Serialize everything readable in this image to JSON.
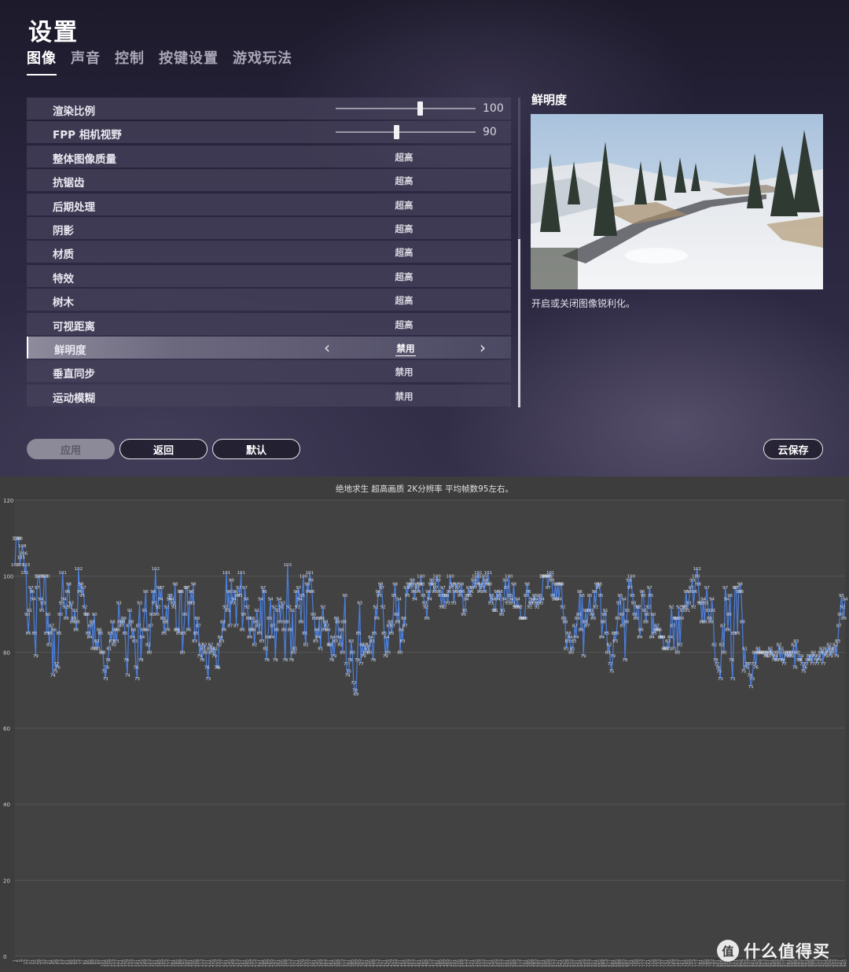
{
  "settings": {
    "title": "设置",
    "tabs": [
      {
        "label": "图像",
        "active": true
      },
      {
        "label": "声音",
        "active": false
      },
      {
        "label": "控制",
        "active": false
      },
      {
        "label": "按键设置",
        "active": false
      },
      {
        "label": "游戏玩法",
        "active": false
      }
    ],
    "rows": [
      {
        "label": "渲染比例",
        "type": "slider",
        "value": "100",
        "fraction": 0.6
      },
      {
        "label": "FPP 相机视野",
        "type": "slider",
        "value": "90",
        "fraction": 0.43
      },
      {
        "label": "整体图像质量",
        "type": "option",
        "value": "超高"
      },
      {
        "label": "抗锯齿",
        "type": "option",
        "value": "超高"
      },
      {
        "label": "后期处理",
        "type": "option",
        "value": "超高"
      },
      {
        "label": "阴影",
        "type": "option",
        "value": "超高"
      },
      {
        "label": "材质",
        "type": "option",
        "value": "超高"
      },
      {
        "label": "特效",
        "type": "option",
        "value": "超高"
      },
      {
        "label": "树木",
        "type": "option",
        "value": "超高"
      },
      {
        "label": "可视距离",
        "type": "option",
        "value": "超高"
      },
      {
        "label": "鲜明度",
        "type": "option",
        "value": "禁用",
        "selected": true
      },
      {
        "label": "垂直同步",
        "type": "option",
        "value": "禁用"
      },
      {
        "label": "运动模糊",
        "type": "option",
        "value": "禁用"
      }
    ],
    "preview": {
      "title": "鲜明度",
      "description": "开启或关闭图像锐利化。"
    },
    "buttons": {
      "apply": "应用",
      "back": "返回",
      "default": "默认",
      "cloud_save": "云保存"
    },
    "icons": {
      "prev": "chevron-left-icon",
      "next": "chevron-right-icon"
    }
  },
  "watermark": {
    "badge": "值",
    "text": "什么值得买"
  },
  "chart_data": {
    "type": "line",
    "title": "绝地求生 超高画质 2K分辨率 平均帧数95左右。",
    "ylim": [
      0,
      120
    ],
    "yticks": [
      0,
      20,
      40,
      60,
      80,
      100,
      120
    ],
    "color": "#4a7fe0",
    "x_start": 1,
    "x_end": 945,
    "x_tick_step": 4,
    "grid": true,
    "series": [
      {
        "values": [
          103,
          110,
          110,
          110,
          103,
          105,
          108,
          106,
          101,
          103,
          90,
          85,
          91,
          97,
          96,
          94,
          85,
          79,
          97,
          100,
          100,
          94,
          91,
          93,
          100,
          100,
          85,
          90,
          82,
          85,
          87,
          74,
          86,
          75,
          77,
          76,
          85,
          90,
          93,
          101,
          94,
          92,
          89,
          96,
          98,
          92,
          93,
          88,
          89,
          91,
          86,
          88,
          102,
          96,
          98,
          95,
          97,
          92,
          90,
          90,
          85,
          84,
          87,
          88,
          81,
          90,
          81,
          83,
          81,
          86,
          85,
          80,
          80,
          75,
          73,
          76,
          78,
          81,
          85,
          83,
          88,
          82,
          86,
          83,
          86,
          93,
          88,
          87,
          88,
          89,
          85,
          78,
          74,
          87,
          91,
          88,
          84,
          86,
          83,
          76,
          73,
          87,
          93,
          78,
          84,
          86,
          91,
          96,
          86,
          82,
          80,
          87,
          90,
          96,
          93,
          102,
          90,
          92,
          97,
          94,
          97,
          89,
          85,
          88,
          92,
          86,
          94,
          95,
          94,
          93,
          92,
          98,
          86,
          86,
          85,
          96,
          96,
          80,
          85,
          90,
          97,
          97,
          86,
          93,
          96,
          93,
          98,
          83,
          85,
          89,
          87,
          79,
          82,
          78,
          81,
          82,
          80,
          76,
          73,
          81,
          82,
          80,
          81,
          79,
          81,
          76,
          76,
          82,
          84,
          83,
          88,
          86,
          92,
          101,
          91,
          96,
          87,
          99,
          93,
          94,
          96,
          87,
          95,
          97,
          95,
          101,
          86,
          90,
          97,
          94,
          92,
          89,
          84,
          86,
          89,
          86,
          82,
          88,
          91,
          87,
          85,
          94,
          83,
          97,
          96,
          81,
          78,
          84,
          89,
          94,
          84,
          87,
          92,
          78,
          86,
          91,
          94,
          88,
          92,
          93,
          86,
          78,
          88,
          103,
          92,
          86,
          78,
          91,
          80,
          81,
          96,
          92,
          97,
          94,
          88,
          95,
          100,
          85,
          82,
          98,
          96,
          101,
          99,
          96,
          90,
          89,
          83,
          86,
          84,
          89,
          81,
          89,
          92,
          86,
          88,
          87,
          86,
          82,
          82,
          78,
          84,
          79,
          83,
          89,
          88,
          84,
          82,
          86,
          80,
          88,
          95,
          77,
          74,
          75,
          78,
          83,
          80,
          72,
          70,
          69,
          78,
          85,
          93,
          77,
          82,
          79,
          82,
          80,
          81,
          82,
          80,
          84,
          83,
          78,
          85,
          92,
          89,
          96,
          95,
          98,
          97,
          92,
          85,
          79,
          84,
          80,
          87,
          88,
          85,
          87,
          95,
          98,
          90,
          88,
          94,
          80,
          86,
          83,
          89,
          87,
          97,
          95,
          98,
          97,
          98,
          99,
          96,
          94,
          98,
          97,
          96,
          98,
          100,
          98,
          95,
          93,
          92,
          89,
          96,
          94,
          98,
          99,
          98,
          96,
          97,
          100,
          99,
          96,
          95,
          92,
          97,
          92,
          95,
          95,
          93,
          96,
          100,
          97,
          98,
          93,
          96,
          98,
          97,
          96,
          95,
          98,
          96,
          90,
          91,
          94,
          95,
          97,
          95,
          96,
          97,
          99,
          97,
          100,
          98,
          101,
          96,
          98,
          97,
          100,
          96,
          99,
          98,
          101,
          98,
          93,
          95,
          94,
          91,
          91,
          96,
          94,
          95,
          96,
          90,
          91,
          94,
          99,
          97,
          93,
          100,
          95,
          94,
          93,
          98,
          92,
          92,
          94,
          92,
          92,
          89,
          89,
          89,
          89,
          95,
          98,
          96,
          92,
          93,
          94,
          93,
          95,
          94,
          92,
          93,
          95,
          93,
          94,
          100,
          100,
          100,
          100,
          97,
          100,
          101,
          99,
          95,
          94,
          98,
          94,
          98,
          94,
          98,
          98,
          92,
          89,
          88,
          81,
          83,
          85,
          84,
          80,
          81,
          83,
          87,
          84,
          89,
          90,
          96,
          86,
          95,
          79,
          88,
          91,
          87,
          91,
          95,
          91,
          90,
          89,
          96,
          92,
          98,
          97,
          98,
          95,
          84,
          88,
          90,
          91,
          85,
          80,
          82,
          77,
          75,
          79,
          85,
          83,
          85,
          89,
          93,
          95,
          90,
          87,
          94,
          78,
          88,
          91,
          99,
          97,
          100,
          95,
          93,
          90,
          89,
          92,
          92,
          84,
          86,
          96,
          95,
          91,
          88,
          90,
          92,
          97,
          95,
          84,
          90,
          85,
          86,
          87,
          86,
          86,
          84,
          84,
          84,
          81,
          81,
          81,
          83,
          81,
          84,
          92,
          87,
          81,
          89,
          89,
          80,
          92,
          82,
          89,
          91,
          92,
          92,
          96,
          91,
          93,
          96,
          97,
          99,
          92,
          96,
          100,
          102,
          98,
          93,
          93,
          88,
          94,
          88,
          93,
          97,
          91,
          89,
          88,
          94,
          91,
          82,
          78,
          77,
          76,
          75,
          73,
          82,
          87,
          80,
          97,
          94,
          86,
          90,
          95,
          78,
          73,
          85,
          97,
          97,
          85,
          96,
          98,
          96,
          88,
          75,
          81,
          76,
          77,
          77,
          74,
          71,
          73,
          77,
          80,
          76,
          80,
          81,
          80,
          80,
          80,
          80,
          80,
          79,
          79,
          80,
          80,
          81,
          79,
          80,
          78,
          79,
          78,
          80,
          82,
          78,
          81,
          78,
          77,
          80,
          79,
          80,
          79,
          80,
          79,
          80,
          82,
          76,
          83,
          80,
          78,
          78,
          79,
          77,
          75,
          76,
          77,
          78,
          79,
          78,
          79,
          77,
          80,
          79,
          78,
          77,
          79,
          78,
          80,
          81,
          77,
          80,
          79,
          81,
          80,
          82,
          79,
          81,
          80,
          81,
          82,
          79,
          83,
          87,
          90,
          95,
          92,
          89,
          94
        ]
      }
    ]
  }
}
